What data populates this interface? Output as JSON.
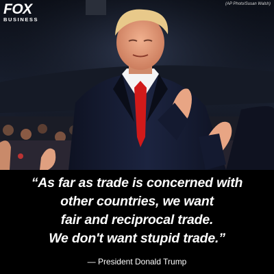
{
  "brand": {
    "logo_text": "FOX",
    "logo_subtext": "BUSINESS"
  },
  "photo": {
    "credit": "(AP Photo/Susan Walsh)",
    "description_icon": "photo-applauding-man"
  },
  "quote": {
    "lines": [
      "“As far as trade is concerned with",
      "other countries, we want",
      "fair and reciprocal trade.",
      "We don't want stupid trade.”"
    ],
    "attribution": "— President Donald Trump"
  },
  "colors": {
    "background": "#000000",
    "suit": "#161b2e",
    "tie": "#d11a1a",
    "skin": "#e59a7a",
    "hair": "#e8c98a",
    "text": "#ffffff"
  }
}
